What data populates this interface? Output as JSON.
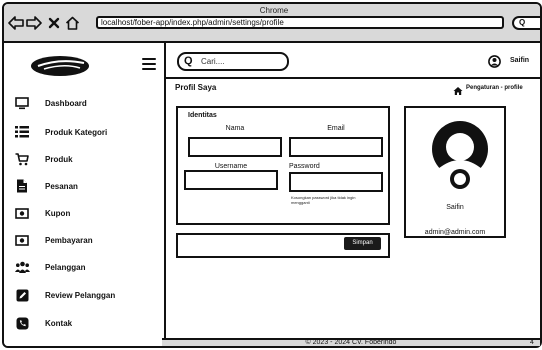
{
  "browser": {
    "title": "Chrome",
    "url": "localhost/fober-app/index.php/admin/settings/profile",
    "back_icon": "arrow-left-icon",
    "forward_icon": "arrow-right-icon",
    "close_icon": "close-icon",
    "home_icon": "home-icon",
    "search_glyph": "Q"
  },
  "sidebar": {
    "items": [
      {
        "label": "Dashboard",
        "icon": "monitor-icon"
      },
      {
        "label": "Produk Kategori",
        "icon": "list-icon"
      },
      {
        "label": "Produk",
        "icon": "cart-icon"
      },
      {
        "label": "Pesanan",
        "icon": "document-icon"
      },
      {
        "label": "Kupon",
        "icon": "coupon-icon"
      },
      {
        "label": "Pembayaran",
        "icon": "payment-icon"
      },
      {
        "label": "Pelanggan",
        "icon": "users-icon"
      },
      {
        "label": "Review Pelanggan",
        "icon": "edit-icon"
      },
      {
        "label": "Kontak",
        "icon": "phone-icon"
      }
    ]
  },
  "header": {
    "search_placeholder": "Cari....",
    "search_glyph": "Q",
    "user_name": "Saifin"
  },
  "page": {
    "title": "Profil Saya",
    "breadcrumb": "Pengaturan - profile"
  },
  "identity_form": {
    "title": "Identitas",
    "name_label": "Nama",
    "email_label": "Email",
    "username_label": "Username",
    "password_label": "Password",
    "password_hint": "Kosongkan password jika tidak ingin mengganti",
    "save_label": "Simpan"
  },
  "profile_card": {
    "name": "Saifin",
    "email": "admin@admin.com"
  },
  "footer": {
    "text": "© 2023 - 2024 CV. Foberindo",
    "corner": "4"
  }
}
